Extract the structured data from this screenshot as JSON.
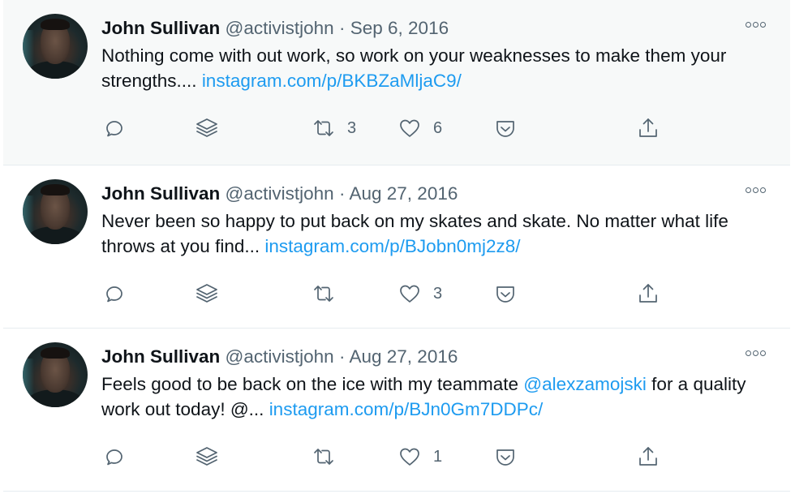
{
  "tweets": [
    {
      "name": "John Sullivan",
      "handle": "@activistjohn",
      "separator": "·",
      "date": "Sep 6, 2016",
      "text": "Nothing come with out work, so work on your weaknesses to make them your strengths.... ",
      "link": "instagram.com/p/BKBZaMljaC9/",
      "retweets": "3",
      "likes": "6"
    },
    {
      "name": "John Sullivan",
      "handle": "@activistjohn",
      "separator": "·",
      "date": "Aug 27, 2016",
      "text": "Never been so happy to put back on my skates and skate. No matter what life throws at you find... ",
      "link": "instagram.com/p/BJobn0mj2z8/",
      "retweets": "",
      "likes": "3"
    },
    {
      "name": "John Sullivan",
      "handle": "@activistjohn",
      "separator": "·",
      "date": "Aug 27, 2016",
      "text_before_mention": "Feels good to be back on the ice with my teammate ",
      "mention": "@alexzamojski",
      "text_after_mention": " for a quality work out today! @... ",
      "link": "instagram.com/p/BJn0Gm7DDPc/",
      "retweets": "",
      "likes": "1"
    }
  ],
  "icons": {
    "reply": "reply-icon",
    "layers": "layers-icon",
    "retweet": "retweet-icon",
    "like": "heart-icon",
    "save": "save-icon",
    "share": "share-icon",
    "more": "more-icon"
  },
  "colors": {
    "link": "#1d9bf0",
    "secondary_text": "#536471",
    "highlight_background": "#f7f9f9"
  }
}
